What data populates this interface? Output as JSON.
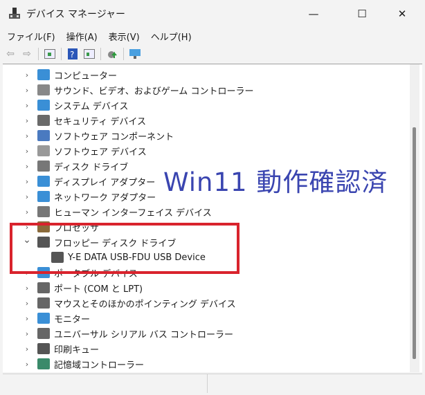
{
  "window": {
    "title": "デバイス マネージャー",
    "minimize": "—",
    "maximize": "☐",
    "close": "✕"
  },
  "menu": [
    "ファイル(F)",
    "操作(A)",
    "表示(V)",
    "ヘルプ(H)"
  ],
  "toolbar": [
    "back-icon",
    "forward-icon",
    "properties-pane-icon",
    "help-icon",
    "action-pane-icon",
    "update-driver-icon",
    "scan-hardware-icon"
  ],
  "tree": [
    {
      "label": "コンピューター",
      "color": "#3a8fd6"
    },
    {
      "label": "サウンド、ビデオ、およびゲーム コントローラー",
      "color": "#888"
    },
    {
      "label": "システム デバイス",
      "color": "#3a8fd6"
    },
    {
      "label": "セキュリティ デバイス",
      "color": "#6a6a6a"
    },
    {
      "label": "ソフトウェア コンポーネント",
      "color": "#4a7ac0"
    },
    {
      "label": "ソフトウェア デバイス",
      "color": "#999"
    },
    {
      "label": "ディスク ドライブ",
      "color": "#777"
    },
    {
      "label": "ディスプレイ アダプター",
      "color": "#3a8fd6"
    },
    {
      "label": "ネットワーク アダプター",
      "color": "#3a8fd6"
    },
    {
      "label": "ヒューマン インターフェイス デバイス",
      "color": "#777"
    },
    {
      "label": "プロセッサ",
      "color": "#8a6a3a"
    },
    {
      "label": "フロッピー ディスク ドライブ",
      "color": "#555",
      "expanded": true
    },
    {
      "label": "Y-E DATA USB-FDU USB Device",
      "color": "#555",
      "child": true
    },
    {
      "label": "ポータブル デバイス",
      "color": "#3a8fd6"
    },
    {
      "label": "ポート (COM と LPT)",
      "color": "#666"
    },
    {
      "label": "マウスとそのほかのポインティング デバイス",
      "color": "#666"
    },
    {
      "label": "モニター",
      "color": "#3a8fd6"
    },
    {
      "label": "ユニバーサル シリアル バス コントローラー",
      "color": "#666"
    },
    {
      "label": "印刷キュー",
      "color": "#555"
    },
    {
      "label": "記憶域コントローラー",
      "color": "#3a8a6a"
    }
  ],
  "overlay": {
    "text": "Win11 動作確認済",
    "color": "#3a45b0"
  },
  "highlight_color": "#d9232d"
}
